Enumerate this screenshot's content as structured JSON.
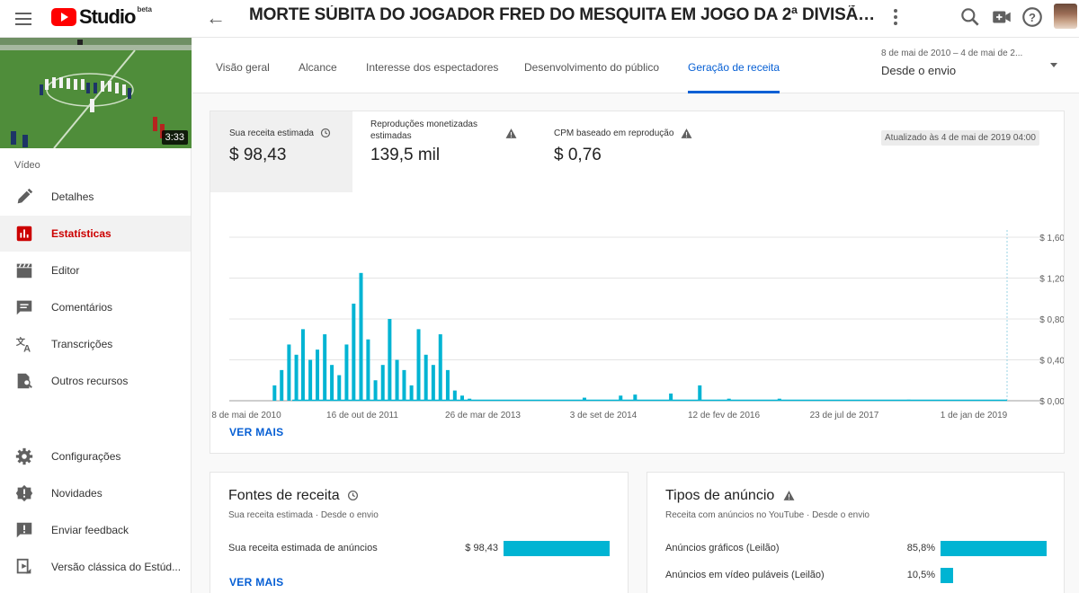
{
  "header": {
    "logo_text": "Studio",
    "logo_badge": "beta",
    "video_title": "MORTE SÚBITA DO JOGADOR FRED DO MESQUITA EM JOGO DA 2ª DIVISÃO DO RJ - P..."
  },
  "sidebar": {
    "thumbnail_duration": "3:33",
    "section_label": "Vídeo",
    "items": [
      {
        "label": "Detalhes",
        "icon": "pencil-icon"
      },
      {
        "label": "Estatísticas",
        "icon": "analytics-icon"
      },
      {
        "label": "Editor",
        "icon": "clapperboard-icon"
      },
      {
        "label": "Comentários",
        "icon": "comment-icon"
      },
      {
        "label": "Transcrições",
        "icon": "translate-icon"
      },
      {
        "label": "Outros recursos",
        "icon": "document-search-icon"
      }
    ],
    "bottom_items": [
      {
        "label": "Configurações",
        "icon": "gear-icon"
      },
      {
        "label": "Novidades",
        "icon": "alert-badge-icon"
      },
      {
        "label": "Enviar feedback",
        "icon": "feedback-icon"
      },
      {
        "label": "Versão clássica do Estúd...",
        "icon": "classic-studio-icon"
      }
    ]
  },
  "tabs": [
    {
      "label": "Visão geral"
    },
    {
      "label": "Alcance"
    },
    {
      "label": "Interesse dos espectadores"
    },
    {
      "label": "Desenvolvimento do público"
    },
    {
      "label": "Geração de receita",
      "active": true
    }
  ],
  "date_range": {
    "sub": "8 de mai de 2010 – 4 de mai de 2...",
    "main": "Desde o envio"
  },
  "metrics": [
    {
      "label": "Sua receita estimada",
      "value": "$ 98,43",
      "icon": "clock-icon"
    },
    {
      "label": "Reproduções monetizadas estimadas",
      "value": "139,5 mil",
      "icon": "warning-icon"
    },
    {
      "label": "CPM baseado em reprodução",
      "value": "$ 0,76",
      "icon": "warning-icon"
    }
  ],
  "updated_text": "Atualizado às 4 de mai de 2019 04:00",
  "see_more": "VER MAIS",
  "colors": {
    "bar": "#00b4d3",
    "accent": "#065fd4",
    "active_nav": "#cc0000"
  },
  "chart_data": {
    "type": "area",
    "y_ticks": [
      "$ 0,00",
      "$ 0,40",
      "$ 0,80",
      "$ 1,20",
      "$ 1,60"
    ],
    "x_ticks": [
      "8 de mai de 2010",
      "16 de out de 2011",
      "26 de mar de 2013",
      "3 de set de 2014",
      "12 de fev de 2016",
      "23 de jul de 2017",
      "1 de jan de 2019"
    ],
    "ylim": [
      0,
      1.6
    ],
    "xlim": [
      "2010-05-08",
      "2019-05-04"
    ],
    "grid": true,
    "series": [
      {
        "values_by_month": [
          [
            "2010-11",
            0.15
          ],
          [
            "2010-12",
            0.3
          ],
          [
            "2011-01",
            0.55
          ],
          [
            "2011-02",
            0.45
          ],
          [
            "2011-03",
            0.7
          ],
          [
            "2011-04",
            0.4
          ],
          [
            "2011-05",
            0.5
          ],
          [
            "2011-06",
            0.65
          ],
          [
            "2011-07",
            0.35
          ],
          [
            "2011-08",
            0.25
          ],
          [
            "2011-09",
            0.55
          ],
          [
            "2011-10",
            0.95
          ],
          [
            "2011-11",
            1.25
          ],
          [
            "2011-12",
            0.6
          ],
          [
            "2012-01",
            0.2
          ],
          [
            "2012-02",
            0.35
          ],
          [
            "2012-03",
            0.8
          ],
          [
            "2012-04",
            0.4
          ],
          [
            "2012-05",
            0.3
          ],
          [
            "2012-06",
            0.15
          ],
          [
            "2012-07",
            0.7
          ],
          [
            "2012-08",
            0.45
          ],
          [
            "2012-09",
            0.35
          ],
          [
            "2012-10",
            0.65
          ],
          [
            "2012-11",
            0.3
          ],
          [
            "2012-12",
            0.1
          ],
          [
            "2013-01",
            0.05
          ],
          [
            "2013-02",
            0.02
          ],
          [
            "2014-06",
            0.03
          ],
          [
            "2014-11",
            0.05
          ],
          [
            "2015-01",
            0.06
          ],
          [
            "2015-06",
            0.07
          ],
          [
            "2015-10",
            0.15
          ],
          [
            "2016-02",
            0.02
          ],
          [
            "2016-09",
            0.02
          ],
          [
            "2018-03",
            0.01
          ]
        ]
      }
    ]
  },
  "revenue_sources": {
    "title": "Fontes de receita",
    "subtitle": "Sua receita estimada · Desde o envio",
    "rows": [
      {
        "label": "Sua receita estimada de anúncios",
        "value": "$ 98,43",
        "fraction": 1.0
      }
    ],
    "see_more": "VER MAIS"
  },
  "ad_types": {
    "title": "Tipos de anúncio",
    "subtitle": "Receita com anúncios no YouTube · Desde o envio",
    "rows": [
      {
        "label": "Anúncios gráficos (Leilão)",
        "value": "85,8%",
        "fraction": 0.858
      },
      {
        "label": "Anúncios em vídeo puláveis (Leilão)",
        "value": "10,5%",
        "fraction": 0.105
      }
    ]
  }
}
